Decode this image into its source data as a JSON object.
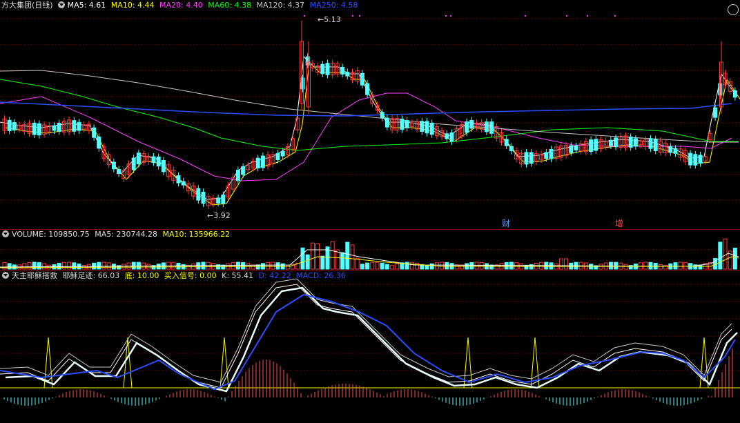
{
  "main": {
    "stock_name": "方大集团(日线)",
    "ma5": "MA5: 4.61",
    "ma10": "MA10: 4.44",
    "ma20": "MA20: 4.40",
    "ma60": "MA60: 4.38",
    "ma120": "MA120: 4.37",
    "ma250": "MA250: 4.58",
    "high_mark": "5.13",
    "low_mark": "3.92",
    "event_cai": "财",
    "event_zeng": "增"
  },
  "volume": {
    "label": "VOLUME: 109850.75",
    "ma5": "MA5: 230744.28",
    "ma10": "MA10: 135966.22"
  },
  "indicator": {
    "name": "天主耶稣搭救",
    "track": "耶稣足迹: 66.03",
    "bottom": "底: 10.00",
    "buy": "买入信号: 0.00",
    "k": "K: 55.41",
    "d": "D: 42.22",
    "macd": "MACD: 26.36"
  },
  "colors": {
    "up": "#ff3b3b",
    "down": "#54ffff",
    "ma5": "#ffffff",
    "ma10": "#ffff00",
    "ma20": "#ff40ff",
    "ma60": "#00ff00",
    "ma120": "#c8c8c8",
    "ma250": "#2d4dff"
  }
}
